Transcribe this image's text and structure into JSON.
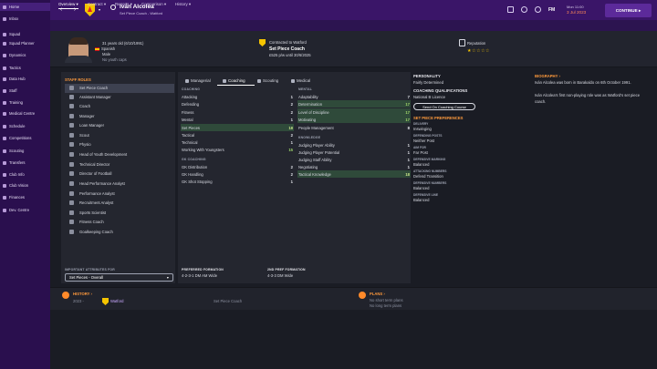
{
  "sidebar": {
    "items": [
      {
        "label": "Home",
        "active": true
      },
      {
        "label": "Inbox"
      },
      {
        "label": "Squad"
      },
      {
        "label": "Squad Planner"
      },
      {
        "label": "Dynamics"
      },
      {
        "label": "Tactics"
      },
      {
        "label": "Data Hub"
      },
      {
        "label": "Staff"
      },
      {
        "label": "Training"
      },
      {
        "label": "Medical Centre"
      },
      {
        "label": "Schedule"
      },
      {
        "label": "Competitions"
      },
      {
        "label": "Scouting"
      },
      {
        "label": "Transfers"
      },
      {
        "label": "Club Info"
      },
      {
        "label": "Club Vision"
      },
      {
        "label": "Finances"
      },
      {
        "label": "Dev. Centre"
      }
    ]
  },
  "topbar": {
    "title": "Iván Alcolea",
    "subtitle": "Set Piece Coach - Watford",
    "fm": "FM",
    "date_day": "Mon 11:00",
    "date": "3 Jul 2023",
    "continue": "CONTINUE"
  },
  "subnav": [
    "Overview",
    "Contract",
    "Reports",
    "Comparison",
    "History"
  ],
  "header": {
    "age": "31 years old (6/10/1991)",
    "nationality": "Spanish",
    "gender": "Male",
    "youth": "No youth caps",
    "contract_label": "Contracted to Watford",
    "contract_role": "Set Piece Coach",
    "contract_terms": "£525 p/w until 30/6/2025",
    "reputation_label": "Reputation",
    "stars": "★☆☆☆☆"
  },
  "staff_roles": {
    "title": "STAFF ROLES",
    "items": [
      "Set Piece Coach",
      "Assistant Manager",
      "Coach",
      "Manager",
      "Loan Manager",
      "Scout",
      "Physio",
      "Head of Youth Development",
      "Technical Director",
      "Director of Football",
      "Head Performance Analyst",
      "Performance Analyst",
      "Recruitment Analyst",
      "Sports Scientist",
      "Fitness Coach",
      "Goalkeeping Coach"
    ],
    "important_label": "IMPORTANT ATTRIBUTES FOR",
    "select_value": "Set Pieces - Overall"
  },
  "tabs": [
    "Managerial",
    "Coaching",
    "Scouting",
    "Medical"
  ],
  "coaching": {
    "title": "COACHING",
    "items": [
      {
        "label": "Attacking",
        "value": "1"
      },
      {
        "label": "Defending",
        "value": "2"
      },
      {
        "label": "Fitness",
        "value": "2"
      },
      {
        "label": "Mental",
        "value": "1"
      },
      {
        "label": "Set Pieces",
        "value": "18"
      },
      {
        "label": "Tactical",
        "value": "2"
      },
      {
        "label": "Technical",
        "value": "1"
      },
      {
        "label": "Working With Youngsters",
        "value": "15"
      }
    ]
  },
  "gk_coaching": {
    "title": "GK COACHING",
    "items": [
      {
        "label": "GK Distribution",
        "value": "2"
      },
      {
        "label": "GK Handling",
        "value": "2"
      },
      {
        "label": "GK Shot Stopping",
        "value": "1"
      }
    ]
  },
  "mental": {
    "title": "MENTAL",
    "items": [
      {
        "label": "Adaptability",
        "value": "7"
      },
      {
        "label": "Determination",
        "value": "17"
      },
      {
        "label": "Level of Discipline",
        "value": "17"
      },
      {
        "label": "Motivating",
        "value": "17"
      },
      {
        "label": "People Management",
        "value": "8"
      }
    ]
  },
  "knowledge": {
    "title": "KNOWLEDGE",
    "items": [
      {
        "label": "Judging Player Ability",
        "value": "1"
      },
      {
        "label": "Judging Player Potential",
        "value": "1"
      },
      {
        "label": "Judging Staff Ability",
        "value": "1"
      },
      {
        "label": "Negotiating",
        "value": "1"
      },
      {
        "label": "Tactical Knowledge",
        "value": "18"
      }
    ]
  },
  "personality": {
    "title": "PERSONALITY",
    "value": "Fairly Determined"
  },
  "qualifications": {
    "title": "COACHING QUALIFICATIONS",
    "value": "National B Licence",
    "button": "Send On Coaching Course"
  },
  "set_piece_prefs": {
    "title": "SET PIECE PREFERENCES",
    "items": [
      {
        "label": "DELIVERY",
        "value": "Inswinging"
      },
      {
        "label": "DEFENDING POSTS",
        "value": "Neither Post"
      },
      {
        "label": "AIM FOR",
        "value": "Far Post"
      },
      {
        "label": "DEFENSIVE MARKING",
        "value": "Balanced"
      },
      {
        "label": "ATTACKING NUMBERS",
        "value": "Defend Transition"
      },
      {
        "label": "DEFENSIVE NUMBERS",
        "value": "Balanced"
      },
      {
        "label": "DEFENSIVE LINE",
        "value": "Balanced"
      }
    ]
  },
  "biography": {
    "title": "BIOGRAPHY",
    "p1": "Iván Alcolea was born in Barakaldo on 6th October 1991.",
    "p2": "Iván Alcolea's first non-playing role was as Watford's set piece coach."
  },
  "formations": {
    "preferred_label": "PREFERRED FORMATION",
    "preferred": "4-2-3-1 DM AM Wide",
    "second_label": "2ND PREF FORMATION",
    "second": "4-3-3 DM Wide"
  },
  "history": {
    "title": "HISTORY",
    "year": "2023 -",
    "club": "Watford",
    "role": "Set Piece Coach"
  },
  "plans": {
    "title": "PLANS",
    "short": "No short term plans",
    "long": "No long term plans"
  }
}
